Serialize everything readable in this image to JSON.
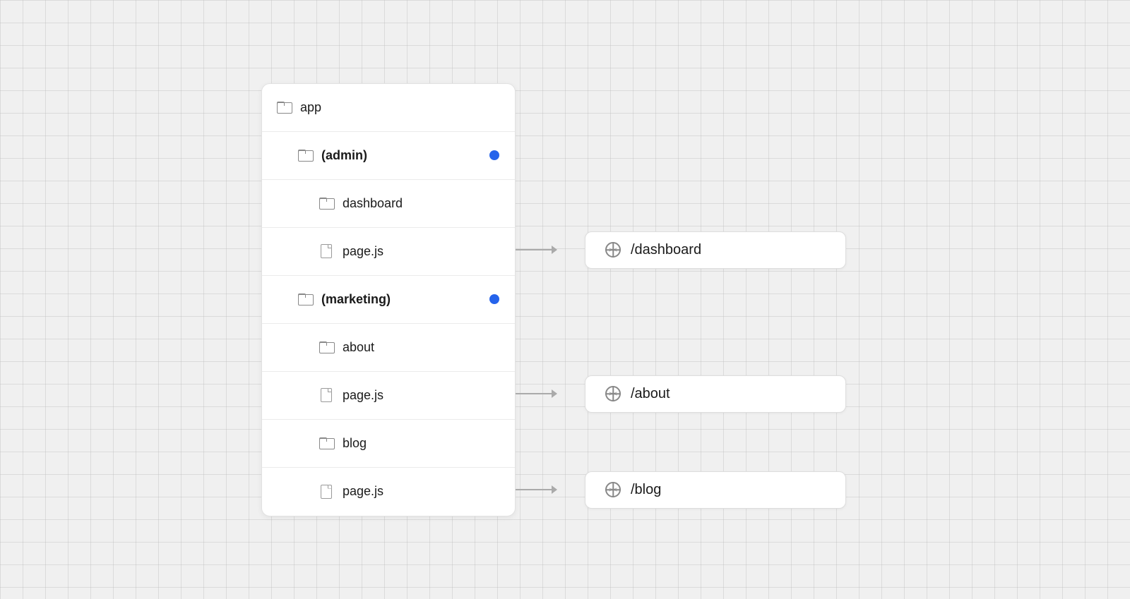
{
  "background": {
    "color": "#f0f0f0"
  },
  "filetree": {
    "rows": [
      {
        "id": "app",
        "level": 0,
        "type": "folder",
        "label": "app",
        "bold": false,
        "dot": false
      },
      {
        "id": "admin",
        "level": 1,
        "type": "folder",
        "label": "(admin)",
        "bold": true,
        "dot": true
      },
      {
        "id": "dashboard",
        "level": 2,
        "type": "folder",
        "label": "dashboard",
        "bold": false,
        "dot": false
      },
      {
        "id": "dashboard-page",
        "level": 2,
        "type": "file",
        "label": "page.js",
        "bold": false,
        "dot": false
      },
      {
        "id": "marketing",
        "level": 1,
        "type": "folder",
        "label": "(marketing)",
        "bold": true,
        "dot": true
      },
      {
        "id": "about",
        "level": 2,
        "type": "folder",
        "label": "about",
        "bold": false,
        "dot": false
      },
      {
        "id": "about-page",
        "level": 2,
        "type": "file",
        "label": "page.js",
        "bold": false,
        "dot": false
      },
      {
        "id": "blog",
        "level": 2,
        "type": "folder",
        "label": "blog",
        "bold": false,
        "dot": false
      },
      {
        "id": "blog-page",
        "level": 2,
        "type": "file",
        "label": "page.js",
        "bold": false,
        "dot": false
      }
    ]
  },
  "routes": [
    {
      "id": "dashboard-route",
      "label": "/dashboard",
      "rowIndex": 3
    },
    {
      "id": "about-route",
      "label": "/about",
      "rowIndex": 6
    },
    {
      "id": "blog-route",
      "label": "/blog",
      "rowIndex": 8
    }
  ]
}
